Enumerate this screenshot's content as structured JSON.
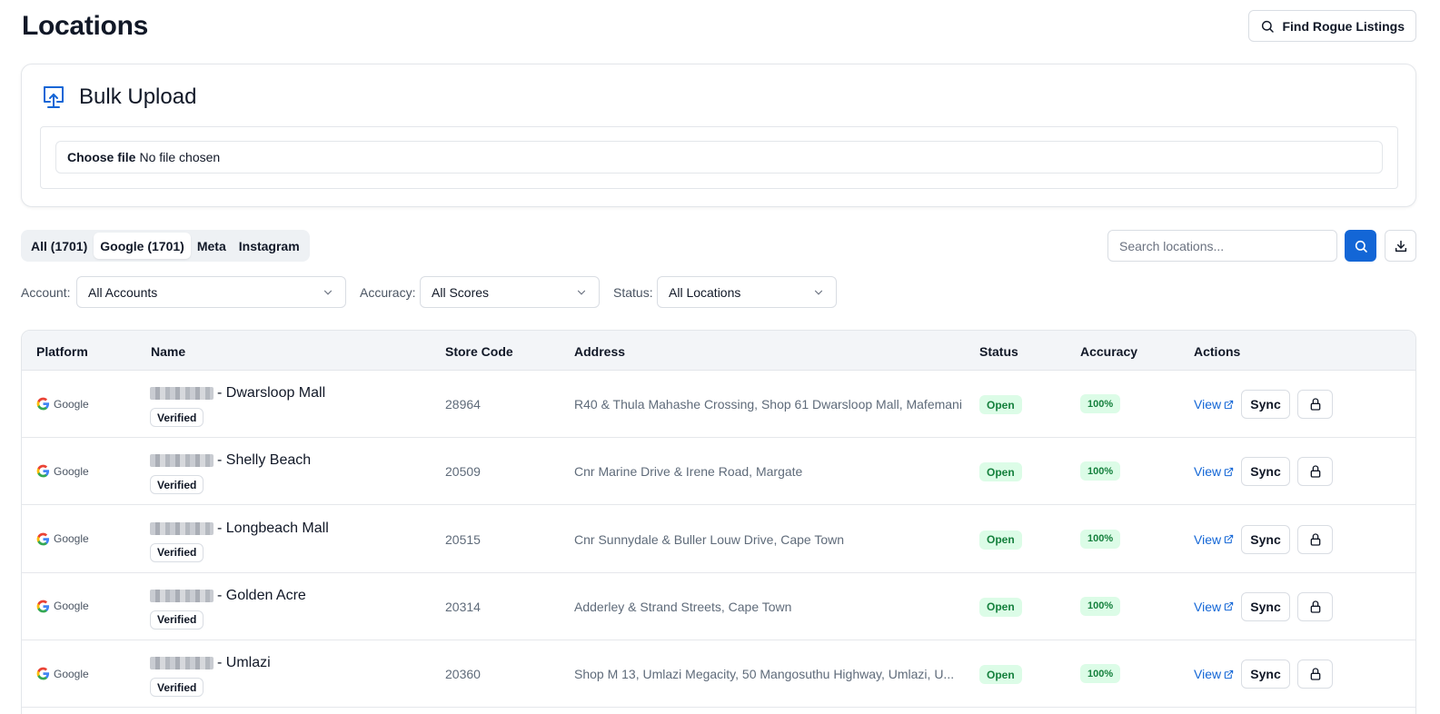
{
  "page": {
    "title": "Locations"
  },
  "header": {
    "rogue_button_label": "Find Rogue Listings"
  },
  "bulk_upload": {
    "title": "Bulk Upload",
    "file_button_label": "Choose file",
    "file_status": "No file chosen"
  },
  "tabs": [
    {
      "label": "All (1701)",
      "active": false
    },
    {
      "label": "Google (1701)",
      "active": true
    },
    {
      "label": "Meta",
      "active": false
    },
    {
      "label": "Instagram",
      "active": false
    }
  ],
  "search": {
    "placeholder": "Search locations..."
  },
  "filters": {
    "account": {
      "label": "Account:",
      "value": "All Accounts"
    },
    "accuracy": {
      "label": "Accuracy:",
      "value": "All Scores"
    },
    "status": {
      "label": "Status:",
      "value": "All Locations"
    }
  },
  "table": {
    "columns": [
      "Platform",
      "Name",
      "Store Code",
      "Address",
      "Status",
      "Accuracy",
      "Actions"
    ],
    "rows": [
      {
        "platform": "Google",
        "name": "- Dwarsloop Mall",
        "badge": "Verified",
        "store_code": "28964",
        "address": "R40 & Thula Mahashe Crossing, Shop 61 Dwarsloop Mall, Mafemani",
        "status": "Open",
        "accuracy": "100%",
        "view_label": "View",
        "sync_label": "Sync"
      },
      {
        "platform": "Google",
        "name": "- Shelly Beach",
        "badge": "Verified",
        "store_code": "20509",
        "address": "Cnr Marine Drive & Irene Road, Margate",
        "status": "Open",
        "accuracy": "100%",
        "view_label": "View",
        "sync_label": "Sync"
      },
      {
        "platform": "Google",
        "name": "- Longbeach Mall",
        "badge": "Verified",
        "store_code": "20515",
        "address": "Cnr Sunnydale & Buller Louw Drive, Cape Town",
        "status": "Open",
        "accuracy": "100%",
        "view_label": "View",
        "sync_label": "Sync"
      },
      {
        "platform": "Google",
        "name": "- Golden Acre",
        "badge": "Verified",
        "store_code": "20314",
        "address": "Adderley & Strand Streets, Cape Town",
        "status": "Open",
        "accuracy": "100%",
        "view_label": "View",
        "sync_label": "Sync"
      },
      {
        "platform": "Google",
        "name": "- Umlazi",
        "badge": "Verified",
        "store_code": "20360",
        "address": "Shop M 13, Umlazi Megacity, 50 Mangosuthu Highway, Umlazi, U...",
        "status": "Open",
        "accuracy": "100%",
        "view_label": "View",
        "sync_label": "Sync"
      }
    ]
  },
  "colors": {
    "primary": "#1366d6",
    "success_bg": "#dcfce7",
    "success_text": "#15803d"
  },
  "icons": {
    "rogue": "search-icon",
    "bulk": "upload-icon",
    "search": "search-icon",
    "download": "download-icon",
    "platform": "google-logo-icon",
    "view": "external-link-icon",
    "lock": "lock-icon",
    "select": "chevron-down-icon"
  }
}
